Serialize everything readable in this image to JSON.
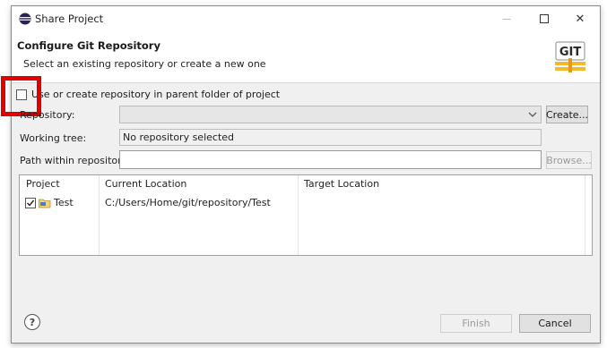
{
  "window": {
    "title": "Share Project",
    "minimize_glyph": "—",
    "close_glyph": "✕"
  },
  "header": {
    "title": "Configure Git Repository",
    "description": "Select an existing repository or create a new one",
    "logo_text": "GIT"
  },
  "form": {
    "use_parent_label": "Use or create repository in parent folder of project",
    "use_parent_checked": false,
    "repository_label": "Repository:",
    "repository_value": "",
    "create_button": "Create...",
    "working_tree_label": "Working tree:",
    "working_tree_value": "No repository selected",
    "path_label": "Path within repository:",
    "path_value": "",
    "browse_button": "Browse..."
  },
  "table": {
    "columns": [
      "Project",
      "Current Location",
      "Target Location"
    ],
    "rows": [
      {
        "project": "Test",
        "checked": true,
        "current_location": "C:/Users/Home/git/repository/Test",
        "target_location": ""
      }
    ]
  },
  "footer": {
    "help_glyph": "?",
    "finish_button": "Finish",
    "cancel_button": "Cancel"
  },
  "colors": {
    "highlight": "#e00000",
    "dialog_bg": "#f0f0f0"
  }
}
